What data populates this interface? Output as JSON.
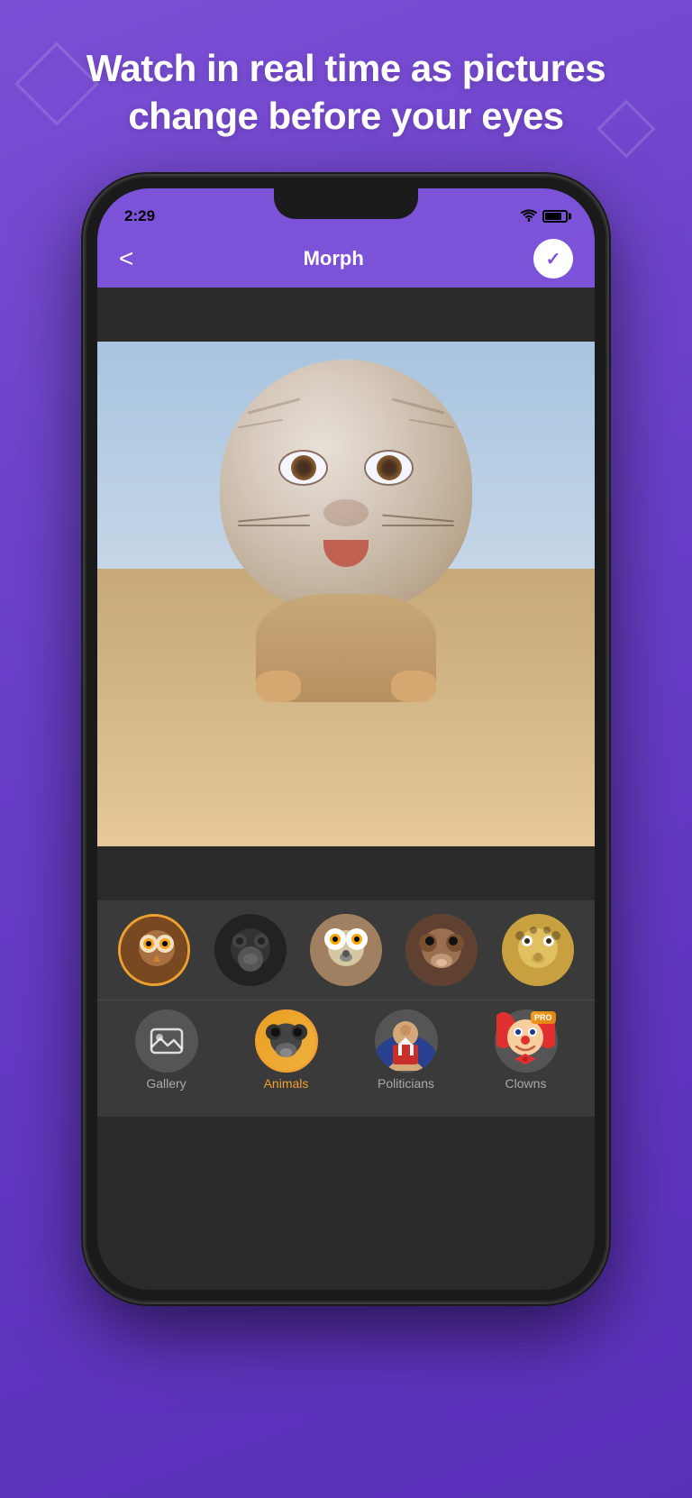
{
  "page": {
    "background_color": "#6a3fc8",
    "headline_line1": "Watch in real time as pictures",
    "headline_line2": "change before your eyes"
  },
  "phone": {
    "status_bar": {
      "time": "2:29",
      "wifi": "wifi",
      "battery": "battery"
    },
    "nav_bar": {
      "back_label": "<",
      "title": "Morph",
      "check_label": "✓"
    }
  },
  "thumbnails": [
    {
      "id": "owl",
      "label": "Owl",
      "selected": true
    },
    {
      "id": "gorilla",
      "label": "Gorilla",
      "selected": false
    },
    {
      "id": "lemur",
      "label": "Lemur",
      "selected": false
    },
    {
      "id": "monkey",
      "label": "Monkey",
      "selected": false
    },
    {
      "id": "leopard",
      "label": "Leopard",
      "selected": false
    }
  ],
  "bottom_nav": [
    {
      "id": "gallery",
      "label": "Gallery",
      "active": false
    },
    {
      "id": "animals",
      "label": "Animals",
      "active": true
    },
    {
      "id": "politicians",
      "label": "Politicians",
      "active": false
    },
    {
      "id": "clowns",
      "label": "Clowns",
      "active": false,
      "pro": true
    }
  ]
}
